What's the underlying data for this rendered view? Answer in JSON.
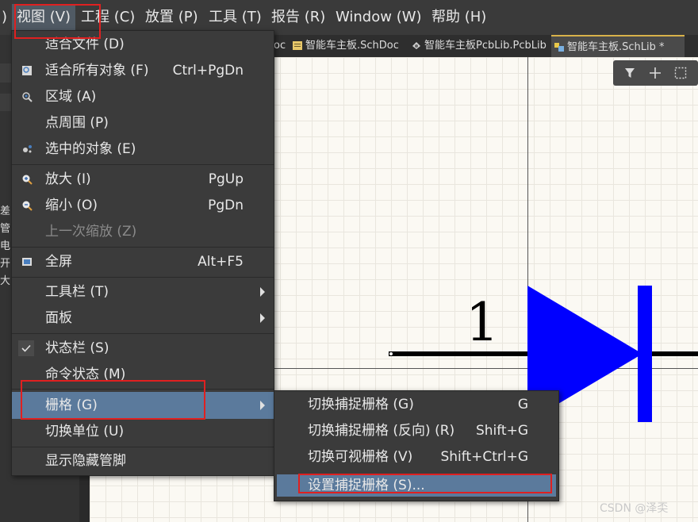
{
  "menubar": {
    "paren": ")",
    "items": [
      {
        "label": "视图 (V)"
      },
      {
        "label": "工程 (C)"
      },
      {
        "label": "放置 (P)"
      },
      {
        "label": "工具 (T)"
      },
      {
        "label": "报告 (R)"
      },
      {
        "label": "Window (W)"
      },
      {
        "label": "帮助 (H)"
      }
    ]
  },
  "tabs": [
    {
      "label": "oc"
    },
    {
      "label": "智能车主板.SchDoc"
    },
    {
      "label": "智能车主板PcbLib.PcbLib"
    },
    {
      "label": "智能车主板.SchLib *"
    }
  ],
  "left_panel_chars": [
    "差",
    "管",
    "电",
    "开",
    "大"
  ],
  "view_menu": {
    "items": [
      {
        "label": "适合文件 (D)",
        "shortcut": ""
      },
      {
        "label": "适合所有对象 (F)",
        "shortcut": "Ctrl+PgDn"
      },
      {
        "label": "区域 (A)",
        "shortcut": ""
      },
      {
        "label": "点周围 (P)",
        "shortcut": ""
      },
      {
        "label": "选中的对象 (E)",
        "shortcut": ""
      },
      {
        "label": "放大 (I)",
        "shortcut": "PgUp"
      },
      {
        "label": "缩小 (O)",
        "shortcut": "PgDn"
      },
      {
        "label": "上一次缩放 (Z)",
        "shortcut": ""
      },
      {
        "label": "全屏",
        "shortcut": "Alt+F5"
      },
      {
        "label": "工具栏 (T)",
        "shortcut": ""
      },
      {
        "label": "面板",
        "shortcut": ""
      },
      {
        "label": "状态栏 (S)",
        "shortcut": ""
      },
      {
        "label": "命令状态 (M)",
        "shortcut": ""
      },
      {
        "label": "栅格 (G)",
        "shortcut": ""
      },
      {
        "label": "切换单位 (U)",
        "shortcut": ""
      },
      {
        "label": "显示隐藏管脚",
        "shortcut": ""
      }
    ]
  },
  "grid_submenu": {
    "items": [
      {
        "label": "切换捕捉栅格 (G)",
        "shortcut": "G"
      },
      {
        "label": "切换捕捉栅格 (反向) (R)",
        "shortcut": "Shift+G"
      },
      {
        "label": "切换可视栅格 (V)",
        "shortcut": "Shift+Ctrl+G"
      },
      {
        "label": "设置捕捉栅格 (S)...",
        "shortcut": ""
      }
    ]
  },
  "canvas": {
    "pin_number": "1",
    "diode_color": "#0000ff",
    "grid_color": "#e9e6de",
    "background": "#fbf9f3"
  },
  "toolbox_icons": [
    "filter-icon",
    "plus-icon",
    "select-rect-icon"
  ],
  "colors": {
    "menu_bg": "#3b3b3b",
    "highlight": "#5b7a9c",
    "annotation_red": "#e02020"
  },
  "watermark": "CSDN @泽奀"
}
